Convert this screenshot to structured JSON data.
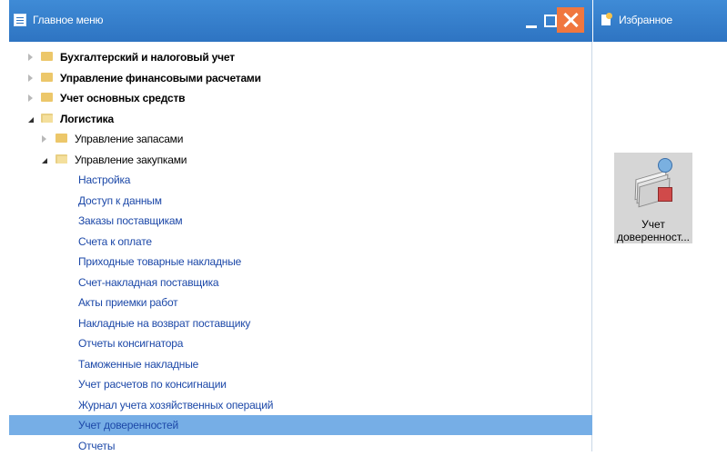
{
  "main_window": {
    "title": "Главное меню",
    "tree": [
      {
        "label": "Бухгалтерский и налоговый учет",
        "level": 0,
        "state": "collapsed",
        "bold": true,
        "folder": true
      },
      {
        "label": "Управление финансовыми расчетами",
        "level": 0,
        "state": "collapsed",
        "bold": true,
        "folder": true
      },
      {
        "label": "Учет основных средств",
        "level": 0,
        "state": "collapsed",
        "bold": true,
        "folder": true
      },
      {
        "label": "Логистика",
        "level": 0,
        "state": "expanded",
        "bold": true,
        "folder": true
      },
      {
        "label": "Управление запасами",
        "level": 1,
        "state": "collapsed",
        "bold": false,
        "folder": true
      },
      {
        "label": "Управление закупками",
        "level": 1,
        "state": "expanded",
        "bold": false,
        "folder": true
      },
      {
        "label": "Настройка",
        "level": 2,
        "state": "leaf"
      },
      {
        "label": "Доступ к данным",
        "level": 2,
        "state": "leaf"
      },
      {
        "label": "Заказы поставщикам",
        "level": 2,
        "state": "leaf"
      },
      {
        "label": "Счета к оплате",
        "level": 2,
        "state": "leaf"
      },
      {
        "label": "Приходные товарные накладные",
        "level": 2,
        "state": "leaf"
      },
      {
        "label": "Счет-накладная поставщика",
        "level": 2,
        "state": "leaf"
      },
      {
        "label": "Акты приемки работ",
        "level": 2,
        "state": "leaf"
      },
      {
        "label": "Накладные на возврат поставщику",
        "level": 2,
        "state": "leaf"
      },
      {
        "label": "Отчеты консигнатора",
        "level": 2,
        "state": "leaf"
      },
      {
        "label": "Таможенные накладные",
        "level": 2,
        "state": "leaf"
      },
      {
        "label": "Учет расчетов по консигнации",
        "level": 2,
        "state": "leaf"
      },
      {
        "label": "Журнал учета хозяйственных операций",
        "level": 2,
        "state": "leaf"
      },
      {
        "label": "Учет доверенностей",
        "level": 2,
        "state": "leaf",
        "selected": true
      },
      {
        "label": "Отчеты",
        "level": 2,
        "state": "leaf"
      }
    ]
  },
  "favorites": {
    "title": "Избранное",
    "items": [
      {
        "label_line1": "Учет",
        "label_line2": "доверенност..."
      }
    ]
  },
  "colors": {
    "titlebar": "#2e74c2",
    "selection": "#76aee6",
    "link_text": "#1c48a8",
    "close_button": "#f0773f",
    "folder": "#ecc76a"
  },
  "icons": {
    "main_window": "menu-window-icon",
    "favorites": "favorites-icon",
    "tile": "power-of-attorney-icon"
  }
}
